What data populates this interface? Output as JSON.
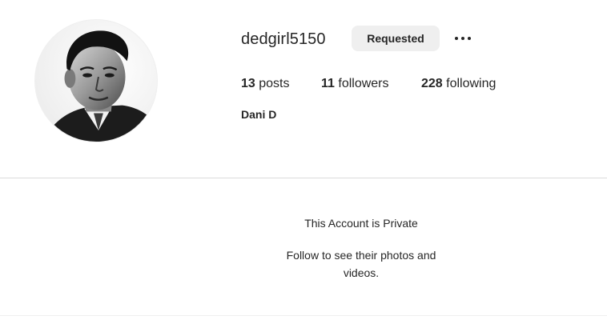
{
  "profile": {
    "username": "dedgirl5150",
    "follow_button_label": "Requested",
    "full_name": "Dani D",
    "avatar_alt": "profile photo"
  },
  "stats": {
    "posts": {
      "count": "13",
      "label": " posts"
    },
    "followers": {
      "count": "11",
      "label": " followers"
    },
    "following": {
      "count": "228",
      "label": " following"
    }
  },
  "private_notice": {
    "title": "This Account is Private",
    "subtitle": "Follow to see their photos and videos."
  },
  "icons": {
    "more": "more-options-icon"
  },
  "colors": {
    "text": "#262626",
    "button_bg": "#efefef",
    "divider": "#dbdbdb"
  }
}
